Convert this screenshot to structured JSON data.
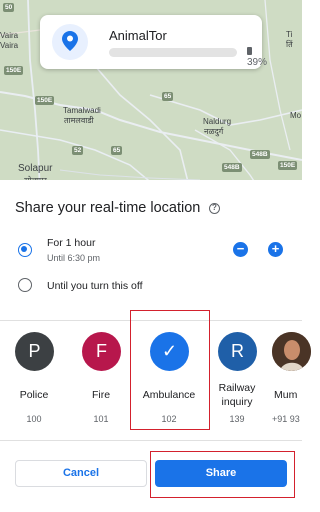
{
  "map": {
    "labels": [
      "Vaira",
      "Vaira",
      "Tamalwadi",
      "तामलवाडी",
      "Naldurg",
      "नळदुर्ग",
      "Solapur",
      "सोलापूर",
      "Ti",
      "तिं",
      "Mo"
    ],
    "shields": [
      "50",
      "150E",
      "150E",
      "65",
      "52",
      "65",
      "548B",
      "548B",
      "150E"
    ]
  },
  "contact_card": {
    "name": "AnimalTor",
    "battery": "39%",
    "pin_icon": "location-pin-icon",
    "battery_icon": "battery-icon"
  },
  "sheet": {
    "title": "Share your real-time location",
    "help_icon": "help-icon",
    "options": [
      {
        "label": "For 1 hour",
        "sub": "Until 6:30 pm",
        "selected": true
      },
      {
        "label": "Until you turn this off",
        "sub": "",
        "selected": false
      }
    ],
    "decrease_label": "−",
    "increase_label": "+"
  },
  "contacts": [
    {
      "initial": "P",
      "name": "Police",
      "number": "100",
      "color": "#3c4043"
    },
    {
      "initial": "F",
      "name": "Fire",
      "number": "101",
      "color": "#b7174c"
    },
    {
      "initial": "✓",
      "name": "Ambulance",
      "number": "102",
      "color": "#1a73e8",
      "selected": true
    },
    {
      "initial": "R",
      "name": "Railway inquiry",
      "name_line1": "Railway",
      "name_line2": "inquiry",
      "number": "139",
      "color": "#1f5fa8"
    },
    {
      "initial": "",
      "name": "Mum",
      "number": "+91 93",
      "color": "#6d4c41"
    }
  ],
  "buttons": {
    "cancel": "Cancel",
    "share": "Share"
  },
  "colors": {
    "accent": "#1a73e8",
    "highlight": "#d3212d"
  }
}
